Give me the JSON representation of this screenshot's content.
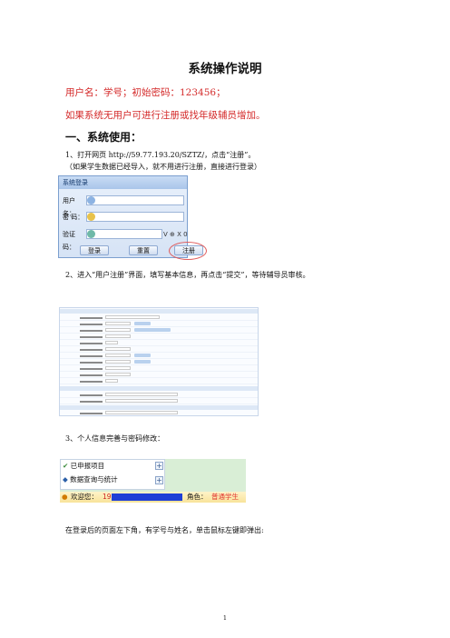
{
  "doc": {
    "title": "系统操作说明",
    "line1": "用户名：学号；初始密码：123456；",
    "line2": "如果系统无用户可进行注册或找年级辅员增加。",
    "section1": "一、系统使用：",
    "step1": "1、打开网页 http://59.77.193.20/SZTZ/，点击“注册”。",
    "step1_note": "（如果学生数据已经导入，就不用进行注册，直接进行登录）",
    "step2": "2、进入“用户注册”界面，填写基本信息，再点击“提交”，等待辅导员审核。",
    "step3": "3、个人信息完善与密码修改：",
    "step4": "在登录后的页面左下角，有学号与姓名，单击鼠标左键即弹出:",
    "page_num": "1"
  },
  "login": {
    "title": "系统登录",
    "username_label": "用户名：",
    "password_label": "密  码：",
    "captcha_label": "验证码：",
    "captcha_text": "V ⊕ X 0",
    "login_btn": "登录",
    "reset_btn": "重置",
    "register_btn": "注册"
  },
  "menu": {
    "item1": "已申报项目",
    "item2": "数据查询与统计",
    "welcome": "欢迎您：",
    "id_prefix": "19",
    "role_label": "角色：",
    "role_value": "普通学生"
  },
  "colors": {
    "red": "#d42a2a",
    "blue_border": "#7b9fcf",
    "role_red": "#e0312d"
  }
}
